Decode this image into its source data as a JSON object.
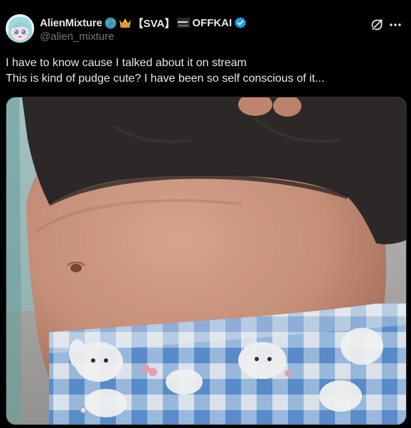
{
  "author": {
    "display_name": "AlienMixture",
    "name_tag_1": "【SVA】",
    "name_tag_2": "OFFKAI",
    "handle": "@alien_mixture",
    "verified_color": "#1d9bf0"
  },
  "icons": {
    "globe": "globe-emoji-icon",
    "crown": "crown-emoji-icon",
    "badge": "soon-badge-icon",
    "verified": "verified-badge-icon",
    "grok": "grok-icon",
    "more": "more-options-icon"
  },
  "tweet": {
    "line_1": "I have to know cause I talked about it on stream",
    "line_2": "This is kind of pudge cute? I have been so self conscious of it..."
  },
  "colors": {
    "background": "#000000",
    "text_primary": "#e7e9ea",
    "text_secondary": "#71767b",
    "border": "#2f3336"
  }
}
